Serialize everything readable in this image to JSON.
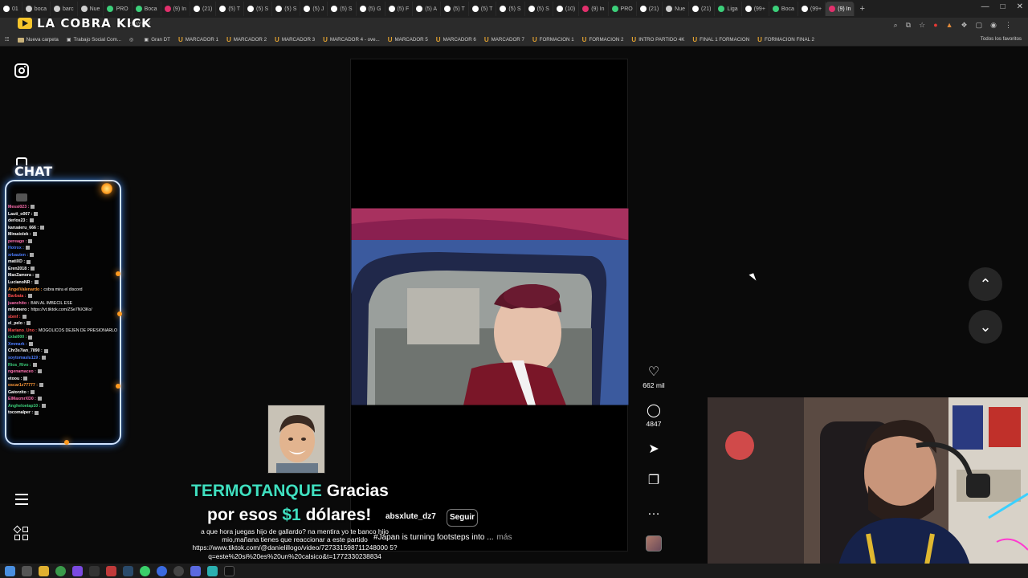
{
  "browser": {
    "tabs": [
      {
        "label": "01",
        "color": "#ffffff"
      },
      {
        "label": "boca",
        "color": "#cfcfcf"
      },
      {
        "label": "barc",
        "color": "#cfcfcf"
      },
      {
        "label": "Nue",
        "color": "#cfcfcf"
      },
      {
        "label": "PRO",
        "color": "#3ccf7a"
      },
      {
        "label": "Boca",
        "color": "#3ccf7a"
      },
      {
        "label": "(9) In",
        "color": "#e1306c"
      },
      {
        "label": "(21)",
        "color": "#ffffff"
      },
      {
        "label": "(5) T",
        "color": "#ffffff"
      },
      {
        "label": "(5) S",
        "color": "#ffffff"
      },
      {
        "label": "(5) S",
        "color": "#ffffff"
      },
      {
        "label": "(5) J",
        "color": "#ffffff"
      },
      {
        "label": "(5) S",
        "color": "#ffffff"
      },
      {
        "label": "(5) G",
        "color": "#ffffff"
      },
      {
        "label": "(5) F",
        "color": "#ffffff"
      },
      {
        "label": "(5) A",
        "color": "#ffffff"
      },
      {
        "label": "(5) T",
        "color": "#ffffff"
      },
      {
        "label": "(5) T",
        "color": "#ffffff"
      },
      {
        "label": "(5) S",
        "color": "#ffffff"
      },
      {
        "label": "(5) S",
        "color": "#ffffff"
      },
      {
        "label": "(10)",
        "color": "#ffffff"
      },
      {
        "label": "(9) In",
        "color": "#e1306c"
      },
      {
        "label": "PRO",
        "color": "#3ccf7a"
      },
      {
        "label": "(21)",
        "color": "#ffffff"
      },
      {
        "label": "Nue",
        "color": "#cfcfcf"
      },
      {
        "label": "(21)",
        "color": "#ffffff"
      },
      {
        "label": "Liga",
        "color": "#3ccf7a"
      },
      {
        "label": "(99+",
        "color": "#ffffff"
      },
      {
        "label": "Boca",
        "color": "#3ccf7a"
      },
      {
        "label": "(99+",
        "color": "#ffffff"
      },
      {
        "label": "(9) In",
        "color": "#e1306c",
        "active": true
      }
    ],
    "url_fragment": "zFqYnR/",
    "all_bookmarks": "Todos los favoritos",
    "bookmarks": [
      {
        "label": "Nueva carpeta",
        "kind": "folder"
      },
      {
        "label": "Trabajo Social Com...",
        "kind": "doc"
      },
      {
        "label": "",
        "kind": "globe"
      },
      {
        "label": "Gran DT",
        "kind": "site"
      },
      {
        "label": "MARCADOR 1",
        "kind": "u"
      },
      {
        "label": "MARCADOR 2",
        "kind": "u"
      },
      {
        "label": "MARCADOR 3",
        "kind": "u"
      },
      {
        "label": "MARCADOR 4 - ove...",
        "kind": "u"
      },
      {
        "label": "MARCADOR 5",
        "kind": "u"
      },
      {
        "label": "MARCADOR 6",
        "kind": "u"
      },
      {
        "label": "MARCADOR 7",
        "kind": "u"
      },
      {
        "label": "FORMACION 1",
        "kind": "u"
      },
      {
        "label": "FORMACION 2",
        "kind": "u"
      },
      {
        "label": "INTRO PARTIDO 4K",
        "kind": "u"
      },
      {
        "label": "FINAL 1 FORMACION",
        "kind": "u"
      },
      {
        "label": "FORMACION FINAL 2",
        "kind": "u"
      }
    ]
  },
  "overlay": {
    "logo_text": "LA COBRA KICK",
    "chat_title": "CHAT",
    "chat": [
      {
        "user": "Messi023 :",
        "color": "#ff6fb0",
        "text": ""
      },
      {
        "user": "Lauti_o007 :",
        "color": "#ffffff",
        "text": ""
      },
      {
        "user": "derlos23 :",
        "color": "#ffffff",
        "text": ""
      },
      {
        "user": "karuaieru_666 :",
        "color": "#ffffff",
        "text": ""
      },
      {
        "user": "Mirasiolek :",
        "color": "#ffffff",
        "text": ""
      },
      {
        "user": "pereago :",
        "color": "#ff6fb0",
        "text": ""
      },
      {
        "user": "Hotrox :",
        "color": "#4d7dff",
        "text": ""
      },
      {
        "user": "xrbauten :",
        "color": "#4d7dff",
        "text": ""
      },
      {
        "user": "matiXD :",
        "color": "#ffffff",
        "text": ""
      },
      {
        "user": "Eren2018 :",
        "color": "#ffffff",
        "text": ""
      },
      {
        "user": "MaxZamora :",
        "color": "#ffffff",
        "text": ""
      },
      {
        "user": "LucianoNR :",
        "color": "#ffffff",
        "text": ""
      },
      {
        "user": "AngelValenardo :",
        "color": "#ff9a3a",
        "text": "cobra mira el discord"
      },
      {
        "user": "Barbata :",
        "color": "#ff4d4d",
        "text": ""
      },
      {
        "user": "juanchito :",
        "color": "#ff6fb0",
        "text": "BAN AL IMBECIL ESE"
      },
      {
        "user": "milomero :",
        "color": "#ffffff",
        "text": "https://vt.tiktok.com/ZSe7NX3Ko/"
      },
      {
        "user": "sbmf :",
        "color": "#ff4d4d",
        "text": ""
      },
      {
        "user": "el_pelo :",
        "color": "#ffffff",
        "text": ""
      },
      {
        "user": "Mariano_Uno :",
        "color": "#ff4d4d",
        "text": "MOGOLICOS DEJEN DE PRESIONARLO"
      },
      {
        "user": "cxlai000 :",
        "color": "#3ccf7a",
        "text": ""
      },
      {
        "user": "Xmmark :",
        "color": "#4d7dff",
        "text": ""
      },
      {
        "user": "Chr3s7ian_7890 :",
        "color": "#ffffff",
        "text": ""
      },
      {
        "user": "soytomaslu119 :",
        "color": "#4d7dff",
        "text": ""
      },
      {
        "user": "Rios_Rivo :",
        "color": "#3ccf7a",
        "text": ""
      },
      {
        "user": "ngenamaceo :",
        "color": "#ff6fb0",
        "text": ""
      },
      {
        "user": "etoou :",
        "color": "#ffffff",
        "text": ""
      },
      {
        "user": "oscar1z77777 :",
        "color": "#ff9a3a",
        "text": ""
      },
      {
        "user": "Gatorzito :",
        "color": "#ffffff",
        "text": ""
      },
      {
        "user": "ElMaxmrXD0 :",
        "color": "#ff6fb0",
        "text": ""
      },
      {
        "user": "Angheloetap10 :",
        "color": "#3ccf7a",
        "text": ""
      },
      {
        "user": "tocomalper :",
        "color": "#ffffff",
        "text": ""
      }
    ],
    "donation": {
      "name": "TERMOTANQUE",
      "line1_rest": "Gracias",
      "line2_a": "por esos",
      "amount": "$1",
      "line2_b": "dólares!",
      "message": "a que hora juegas hijo de gallardo? na mentira yo te banco hijo mio,mañana tienes que reaccionar a este partido https://www.tiktok.com/@danielillogo/video/727331598711248000 5?q=este%20si%20es%20un%20calsico&t=1772330238834"
    }
  },
  "instagram": {
    "reel": {
      "username": "absxlute_dz7",
      "follow_label": "Seguir",
      "caption": "#Japan is turning footsteps into ...",
      "caption_more": "más"
    },
    "actions": {
      "likes": "662 mil",
      "comments": "4847"
    }
  }
}
